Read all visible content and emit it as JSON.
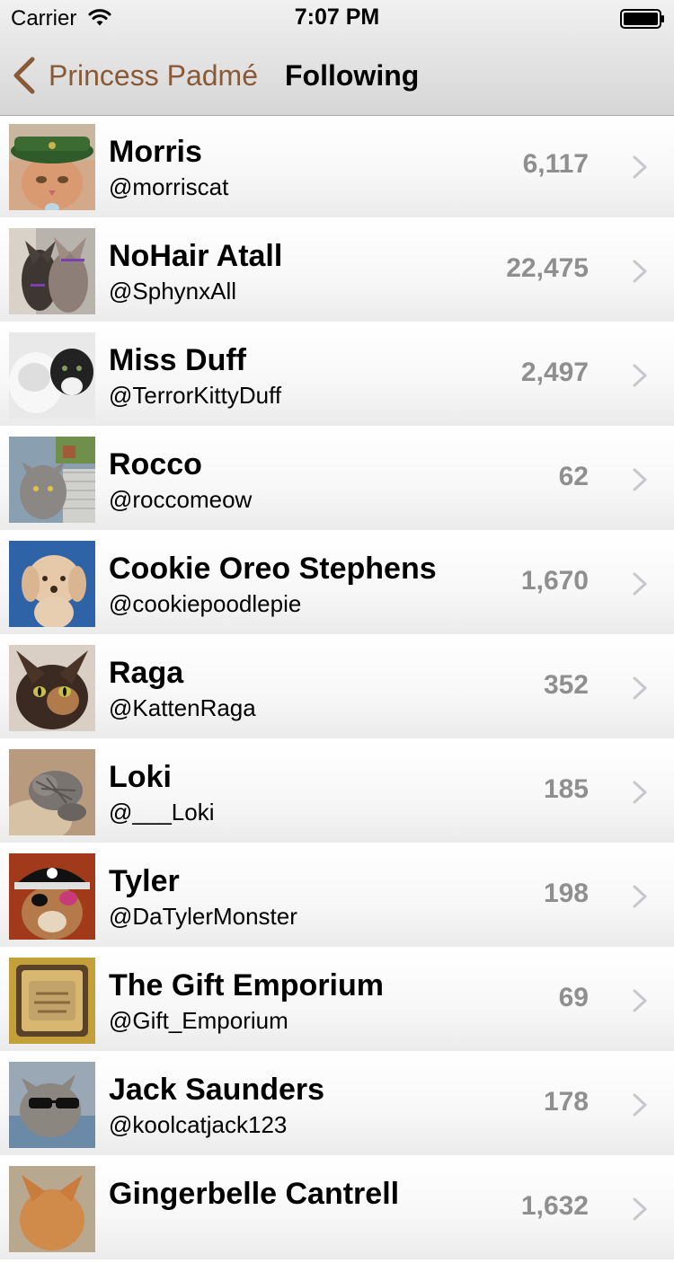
{
  "status_bar": {
    "carrier": "Carrier",
    "time": "7:07 PM"
  },
  "nav": {
    "back_label": "Princess Padmé",
    "title": "Following"
  },
  "colors": {
    "accent": "#8a5a36",
    "count": "#8f8f8f",
    "chevron": "#c7c7cc"
  },
  "following": [
    {
      "name": "Morris",
      "handle": "@morriscat",
      "count": "6,117",
      "avatar": "cat-green-hat"
    },
    {
      "name": "NoHair Atall",
      "handle": "@SphynxAll",
      "count": "22,475",
      "avatar": "sphynx-cats"
    },
    {
      "name": "Miss Duff",
      "handle": "@TerrorKittyDuff",
      "count": "2,497",
      "avatar": "white-black-cat"
    },
    {
      "name": "Rocco",
      "handle": "@roccomeow",
      "count": "62",
      "avatar": "grey-cat-chair"
    },
    {
      "name": "Cookie Oreo Stephens",
      "handle": "@cookiepoodlepie",
      "count": "1,670",
      "avatar": "poodle-puppy"
    },
    {
      "name": "Raga",
      "handle": "@KattenRaga",
      "count": "352",
      "avatar": "tortoiseshell-cat"
    },
    {
      "name": "Loki",
      "handle": "@___Loki",
      "count": "185",
      "avatar": "grey-cat-sleeping"
    },
    {
      "name": "Tyler",
      "handle": "@DaTylerMonster",
      "count": "198",
      "avatar": "pirate-cat"
    },
    {
      "name": "The Gift Emporium",
      "handle": "@Gift_Emporium",
      "count": "69",
      "avatar": "gift-sign"
    },
    {
      "name": "Jack Saunders",
      "handle": "@koolcatjack123",
      "count": "178",
      "avatar": "cat-sunglasses"
    },
    {
      "name": "Gingerbelle Cantrell",
      "handle": "",
      "count": "1,632",
      "avatar": "ginger-cat"
    }
  ]
}
